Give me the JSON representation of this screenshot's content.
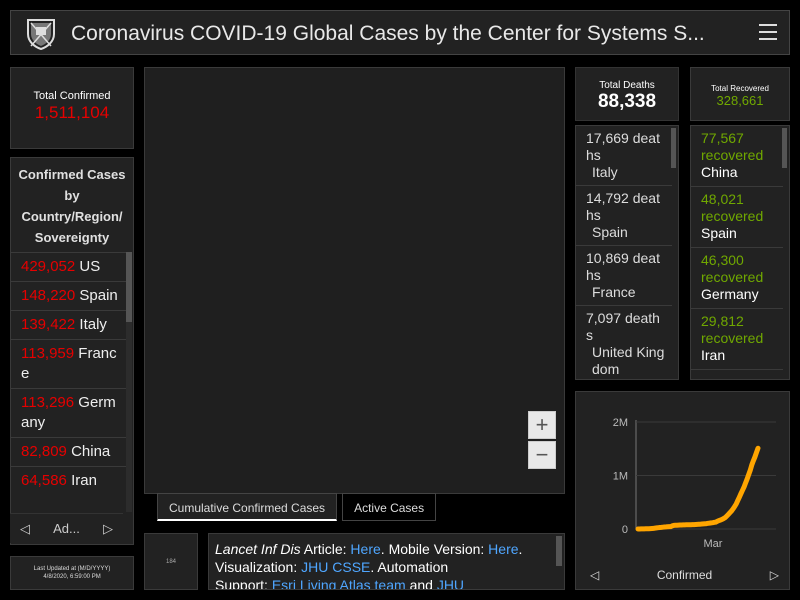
{
  "header": {
    "title": "Coronavirus COVID-19 Global Cases by the Center for Systems S..."
  },
  "total_confirmed": {
    "label": "Total Confirmed",
    "value": "1,511,104"
  },
  "country_list": {
    "heading": "Confirmed Cases by Country/Region/ Sovereignty",
    "items": [
      {
        "count": "429,052",
        "name": "US"
      },
      {
        "count": "148,220",
        "name": "Spain"
      },
      {
        "count": "139,422",
        "name": "Italy"
      },
      {
        "count": "113,959",
        "name": "France"
      },
      {
        "count": "113,296",
        "name": "Germany"
      },
      {
        "count": "82,809",
        "name": "China"
      },
      {
        "count": "64,586",
        "name": "Iran"
      }
    ],
    "pager_label": "Ad..."
  },
  "last_updated": {
    "label": "Last Updated at (M/D/YYYY)",
    "value": "4/8/2020, 6:59:00 PM"
  },
  "map": {
    "zoom_in": "+",
    "zoom_out": "−"
  },
  "tabs": [
    {
      "label": "Cumulative Confirmed Cases",
      "active": true
    },
    {
      "label": "Active Cases",
      "active": false
    }
  ],
  "info": {
    "thumb": "184",
    "journal": "Lancet Inf Dis",
    "article_label": "Article:",
    "here1": "Here",
    "mobile_label": "Mobile Version:",
    "here2": "Here",
    "viz_label": "Visualization:",
    "viz_link": "JHU CSSE",
    "automation": "Automation",
    "support_label": "Support:",
    "support_link": "Esri Living Atlas team",
    "and": "and",
    "jhu": "JHU"
  },
  "total_deaths": {
    "label": "Total Deaths",
    "value": "88,338"
  },
  "deaths_list": [
    {
      "count": "17,669",
      "unit": "deaths",
      "country": "Italy"
    },
    {
      "count": "14,792",
      "unit": "deaths",
      "country": "Spain"
    },
    {
      "count": "10,869",
      "unit": "deaths",
      "country": "France"
    },
    {
      "count": "7,097",
      "unit": "deaths",
      "country": "United Kingdom"
    }
  ],
  "total_recovered": {
    "label": "Total Recovered",
    "value": "328,661"
  },
  "recovered_list": [
    {
      "count": "77,567",
      "unit": "recovered",
      "country": "China"
    },
    {
      "count": "48,021",
      "unit": "recovered",
      "country": "Spain"
    },
    {
      "count": "46,300",
      "unit": "recovered",
      "country": "Germany"
    },
    {
      "count": "29,812",
      "unit": "recovered",
      "country": "Iran"
    }
  ],
  "chart_footer": {
    "label": "Confirmed"
  },
  "colors": {
    "confirmed": "#e60000",
    "recovered": "#70a800",
    "chart_line": "#ffa500",
    "link": "#4fa6ff"
  },
  "chart_data": {
    "type": "line",
    "title": "",
    "xlabel": "",
    "ylabel": "",
    "y_ticks": [
      "0",
      "1M",
      "2M"
    ],
    "x_ticks": [
      "Mar"
    ],
    "ylim": [
      0,
      2000000
    ],
    "series": [
      {
        "values": [
          555,
          654,
          941,
          1434,
          2118,
          2927,
          5578,
          6166,
          8234,
          9927,
          12038,
          16787,
          19881,
          23892,
          27635,
          30817,
          34391,
          37120,
          40150,
          42762,
          44802,
          45221,
          60368,
          66885,
          69030,
          71224,
          73258,
          75136,
          75639,
          76197,
          76819,
          78572,
          78958,
          79561,
          80406,
          81388,
          82746,
          84112,
          86011,
          88369,
          90306,
          92840,
          95120,
          97886,
          101801,
          105847,
          109821,
          113590,
          118620,
          125875,
          128352,
          145205,
          156101,
          167454,
          181574,
          197102,
          214821,
          242570,
          272208,
          304507,
          336953,
          378235,
          418045,
          467653,
          529591,
          593291,
          660706,
          720117,
          782365,
          857487,
          932605,
          1013157,
          1095917,
          1197405,
          1272115,
          1345101,
          1426096,
          1511104
        ]
      }
    ]
  }
}
